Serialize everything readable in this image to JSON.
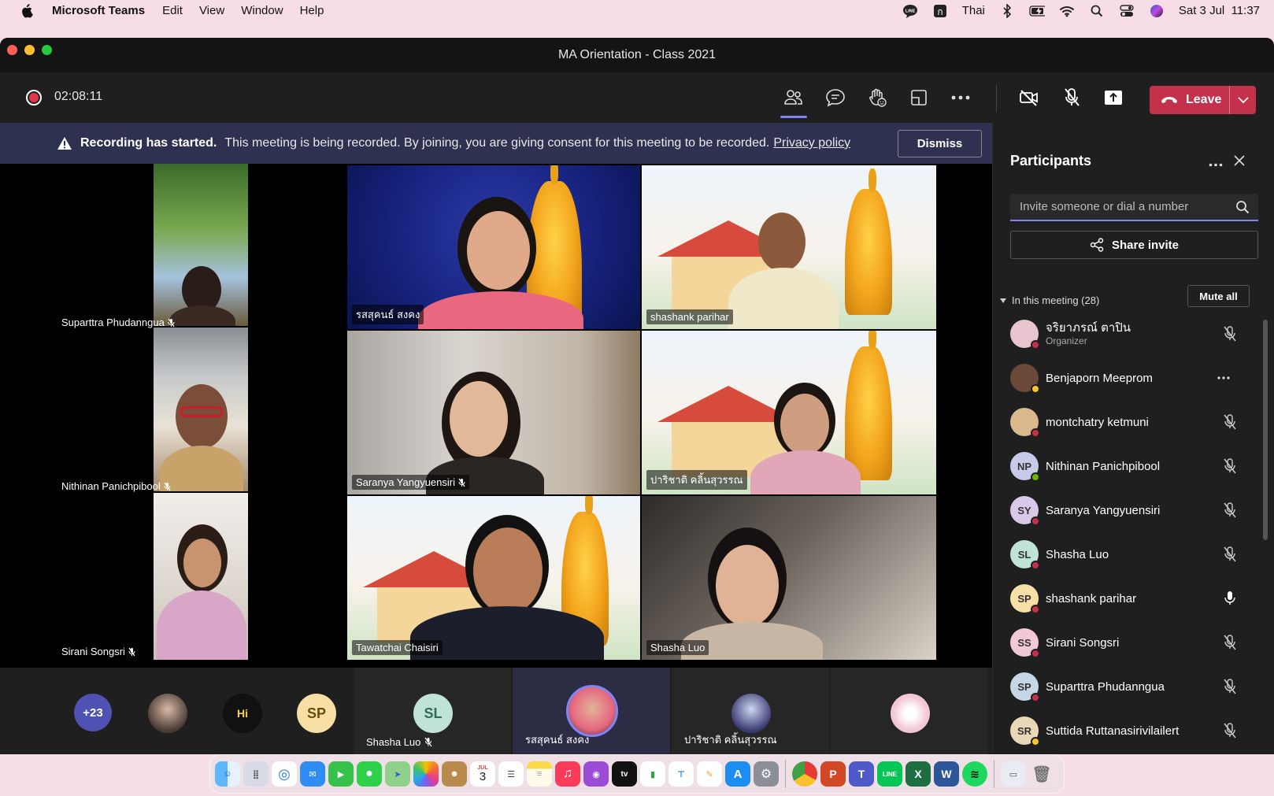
{
  "menubar": {
    "app_name": "Microsoft Teams",
    "items": [
      "Edit",
      "View",
      "Window",
      "Help"
    ],
    "input_source": "Thai",
    "datetime": "Sat 3 Jul  11:37"
  },
  "window": {
    "title": "MA Orientation - Class 2021"
  },
  "controls": {
    "timer": "02:08:11",
    "leave_label": "Leave"
  },
  "banner": {
    "bold": "Recording has started.",
    "text": "This meeting is being recorded. By joining, you are giving consent for this meeting to be recorded.",
    "link": "Privacy policy",
    "dismiss_label": "Dismiss"
  },
  "stage": {
    "side": [
      {
        "name": "Suparttra Phudanngua"
      },
      {
        "name": "Nithinan Panichpibool"
      },
      {
        "name": "Sirani  Songsri"
      }
    ],
    "tiles": [
      {
        "name": "รสสุคนธ์ สงคง"
      },
      {
        "name": "shashank parihar"
      },
      {
        "name": "Saranya  Yangyuensiri"
      },
      {
        "name": "ปาริชาติ คลิ้นสุวรรณ"
      },
      {
        "name": "Tawatchai Chaisiri"
      },
      {
        "name": "Shasha Luo"
      }
    ]
  },
  "strip": {
    "overflow": "+23",
    "sp_initials": "SP",
    "slots": [
      {
        "initials": "SL",
        "name": "Shasha Luo"
      },
      {
        "name": "รสสุคนธ์ สงคง"
      },
      {
        "name": "ปาริชาติ คลิ้นสุวรรณ"
      }
    ]
  },
  "panel": {
    "title": "Participants",
    "invite_placeholder": "Invite someone or dial a number",
    "share_label": "Share invite",
    "section": "In this meeting (28)",
    "mute_all": "Mute all",
    "people": [
      {
        "name": "จริยาภรณ์ ตาปิน",
        "role": "Organizer",
        "initials": "",
        "bg": "#e8c4cf",
        "status": "#c4314b",
        "mic": "muted"
      },
      {
        "name": "Benjaporn Meeprom",
        "role": "",
        "initials": "",
        "bg": "#6b4a3a",
        "status": "#f8c12d",
        "mic": "more"
      },
      {
        "name": "montchatry ketmuni",
        "role": "",
        "initials": "",
        "bg": "#d9b98c",
        "status": "#c4314b",
        "mic": "muted"
      },
      {
        "name": "Nithinan Panichpibool",
        "role": "",
        "initials": "NP",
        "bg": "#c8cbe8",
        "status": "#6bb700",
        "mic": "muted"
      },
      {
        "name": "Saranya Yangyuensiri",
        "role": "",
        "initials": "SY",
        "bg": "#d8c9ea",
        "status": "#c4314b",
        "mic": "muted"
      },
      {
        "name": "Shasha Luo",
        "role": "",
        "initials": "SL",
        "bg": "#bfe3d6",
        "status": "#c4314b",
        "mic": "muted"
      },
      {
        "name": "shashank parihar",
        "role": "",
        "initials": "SP",
        "bg": "#f7dfa5",
        "status": "#c4314b",
        "mic": "on"
      },
      {
        "name": "Sirani Songsri",
        "role": "",
        "initials": "SS",
        "bg": "#f2c8d5",
        "status": "#c4314b",
        "mic": "muted"
      },
      {
        "name": "Suparttra Phudanngua",
        "role": "",
        "initials": "SP",
        "bg": "#c5d7e6",
        "status": "#c4314b",
        "mic": "muted"
      },
      {
        "name": "Suttida Ruttanasirivilailert",
        "role": "",
        "initials": "SR",
        "bg": "#ead7b8",
        "status": "#f8c12d",
        "mic": "muted"
      }
    ]
  },
  "dock": {
    "calendar_day": "3",
    "calendar_month": "JUL"
  }
}
